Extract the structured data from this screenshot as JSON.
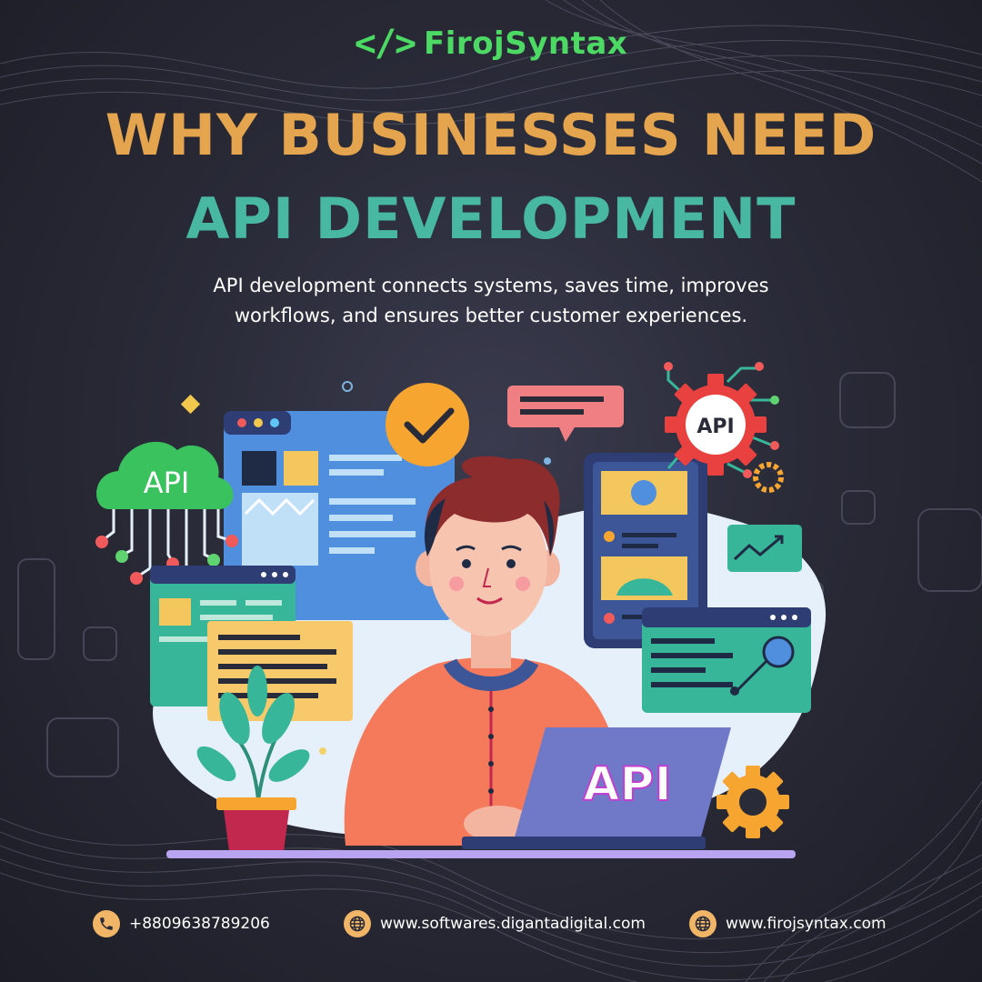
{
  "brand": {
    "logo_glyph": "</>",
    "name": "FirojSyntax"
  },
  "headline": {
    "line1": "WHY BUSINESSES NEED",
    "line2": "API DEVELOPMENT"
  },
  "subtitle": "API development connects systems, saves time, improves workflows, and ensures better customer experiences.",
  "illustration": {
    "cloud_label": "API",
    "gear_label": "API",
    "laptop_label": "API"
  },
  "footer": {
    "phone": {
      "icon": "phone-icon",
      "text": "+8809638789206"
    },
    "website1": {
      "icon": "globe-icon",
      "text": "www.softwares.digantadigital.com"
    },
    "website2": {
      "icon": "globe-icon",
      "text": "www.firojsyntax.com"
    }
  },
  "colors": {
    "background": "#2a2b38",
    "brand_green": "#4cd964",
    "headline_orange": "#e5a54e",
    "headline_teal": "#49b8a2",
    "footer_icon": "#f0b567"
  }
}
